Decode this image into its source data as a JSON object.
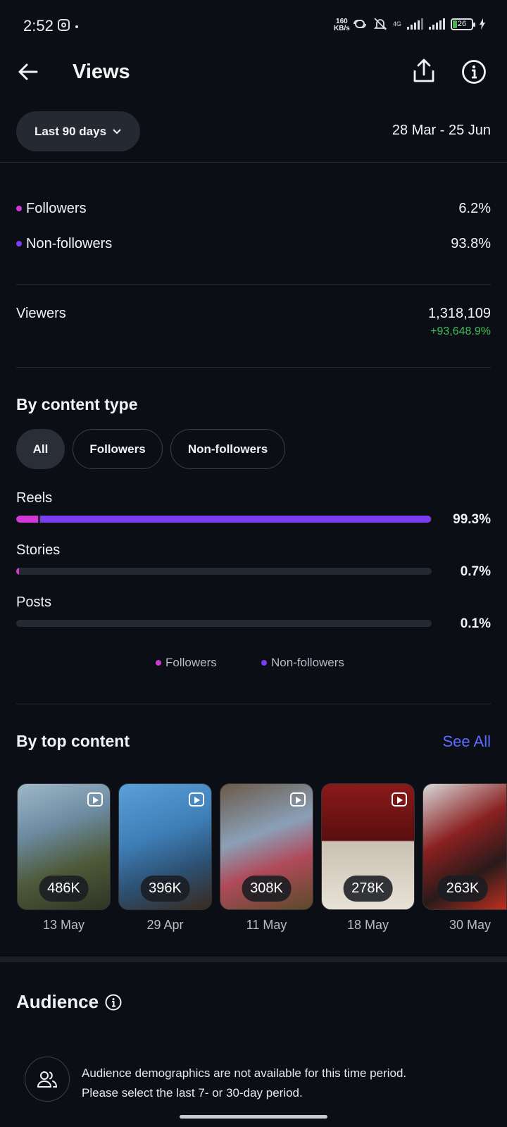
{
  "status_bar": {
    "time": "2:52",
    "speed_top": "160",
    "speed_bottom": "KB/s",
    "network": "4G",
    "battery": "26"
  },
  "header": {
    "title": "Views"
  },
  "filter": {
    "period_label": "Last 90 days",
    "date_range": "28 Mar - 25 Jun"
  },
  "split": {
    "followers_label": "Followers",
    "followers_value": "6.2%",
    "nonfollowers_label": "Non-followers",
    "nonfollowers_value": "93.8%"
  },
  "viewers": {
    "label": "Viewers",
    "value": "1,318,109",
    "change": "+93,648.9%"
  },
  "content_type": {
    "title": "By content type",
    "chips": [
      "All",
      "Followers",
      "Non-followers"
    ],
    "active_chip": "All",
    "rows": [
      {
        "label": "Reels",
        "pct": "99.3%",
        "followers_fraction": 0.053,
        "nonfollowers_fraction": 0.94
      },
      {
        "label": "Stories",
        "pct": "0.7%",
        "followers_fraction": 0.006,
        "nonfollowers_fraction": 0.0
      },
      {
        "label": "Posts",
        "pct": "0.1%",
        "followers_fraction": 0.0,
        "nonfollowers_fraction": 0.0
      }
    ],
    "legend_followers": "Followers",
    "legend_nonfollowers": "Non-followers",
    "colors": {
      "followers": "#d238d6",
      "nonfollowers": "#7a3ef0"
    }
  },
  "top_content": {
    "title": "By top content",
    "see_all": "See All",
    "items": [
      {
        "views": "486K",
        "date": "13 May"
      },
      {
        "views": "396K",
        "date": "29 Apr"
      },
      {
        "views": "308K",
        "date": "11 May"
      },
      {
        "views": "278K",
        "date": "18 May"
      },
      {
        "views": "263K",
        "date": "30 May"
      }
    ]
  },
  "audience": {
    "title": "Audience",
    "message_line1": "Audience demographics are not available for this time period.",
    "message_line2": "Please select the last 7- or 30-day period."
  }
}
